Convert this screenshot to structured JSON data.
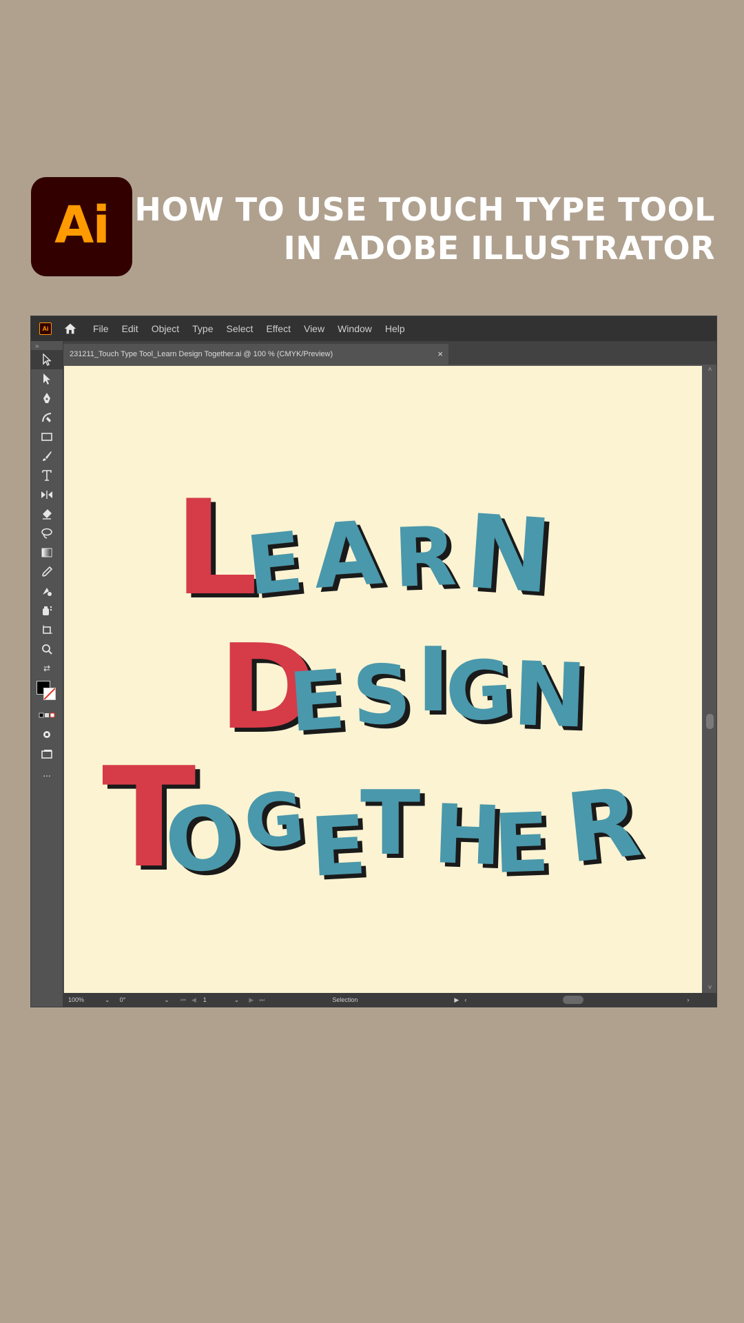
{
  "logo": {
    "text": "Ai",
    "bg": "#330000",
    "fg": "#ff9a00"
  },
  "headline": {
    "line1": "HOW TO USE TOUCH TYPE TOOL",
    "line2": "IN ADOBE ILLUSTRATOR"
  },
  "menubar": {
    "items": [
      "File",
      "Edit",
      "Object",
      "Type",
      "Select",
      "Effect",
      "View",
      "Window",
      "Help"
    ]
  },
  "document_tab": {
    "label": "231211_Touch Type Tool_Learn Design Together.ai @ 100 % (CMYK/Preview)",
    "close": "×"
  },
  "toolbar": {
    "tools": [
      "selection-tool",
      "direct-selection-tool",
      "pen-tool",
      "curvature-tool",
      "rectangle-tool",
      "paintbrush-tool",
      "type-tool",
      "width-tool",
      "eraser-tool",
      "lasso-tool",
      "gradient-tool",
      "eyedropper-tool",
      "blend-tool",
      "symbol-sprayer-tool",
      "artboard-tool",
      "zoom-tool"
    ],
    "more": "..."
  },
  "statusbar": {
    "zoom": "100%",
    "rotation": "0°",
    "artboard": "1",
    "mode": "Selection"
  },
  "artwork": {
    "red": "#d63b48",
    "blue": "#4a98ab",
    "shadow": "#1a1a1a",
    "line1": [
      "L",
      "e",
      "a",
      "r",
      "n"
    ],
    "line2": [
      "D",
      "e",
      "s",
      "i",
      "g",
      "n"
    ],
    "line3": [
      "T",
      "o",
      "g",
      "e",
      "t",
      "h",
      "e",
      "r"
    ]
  }
}
